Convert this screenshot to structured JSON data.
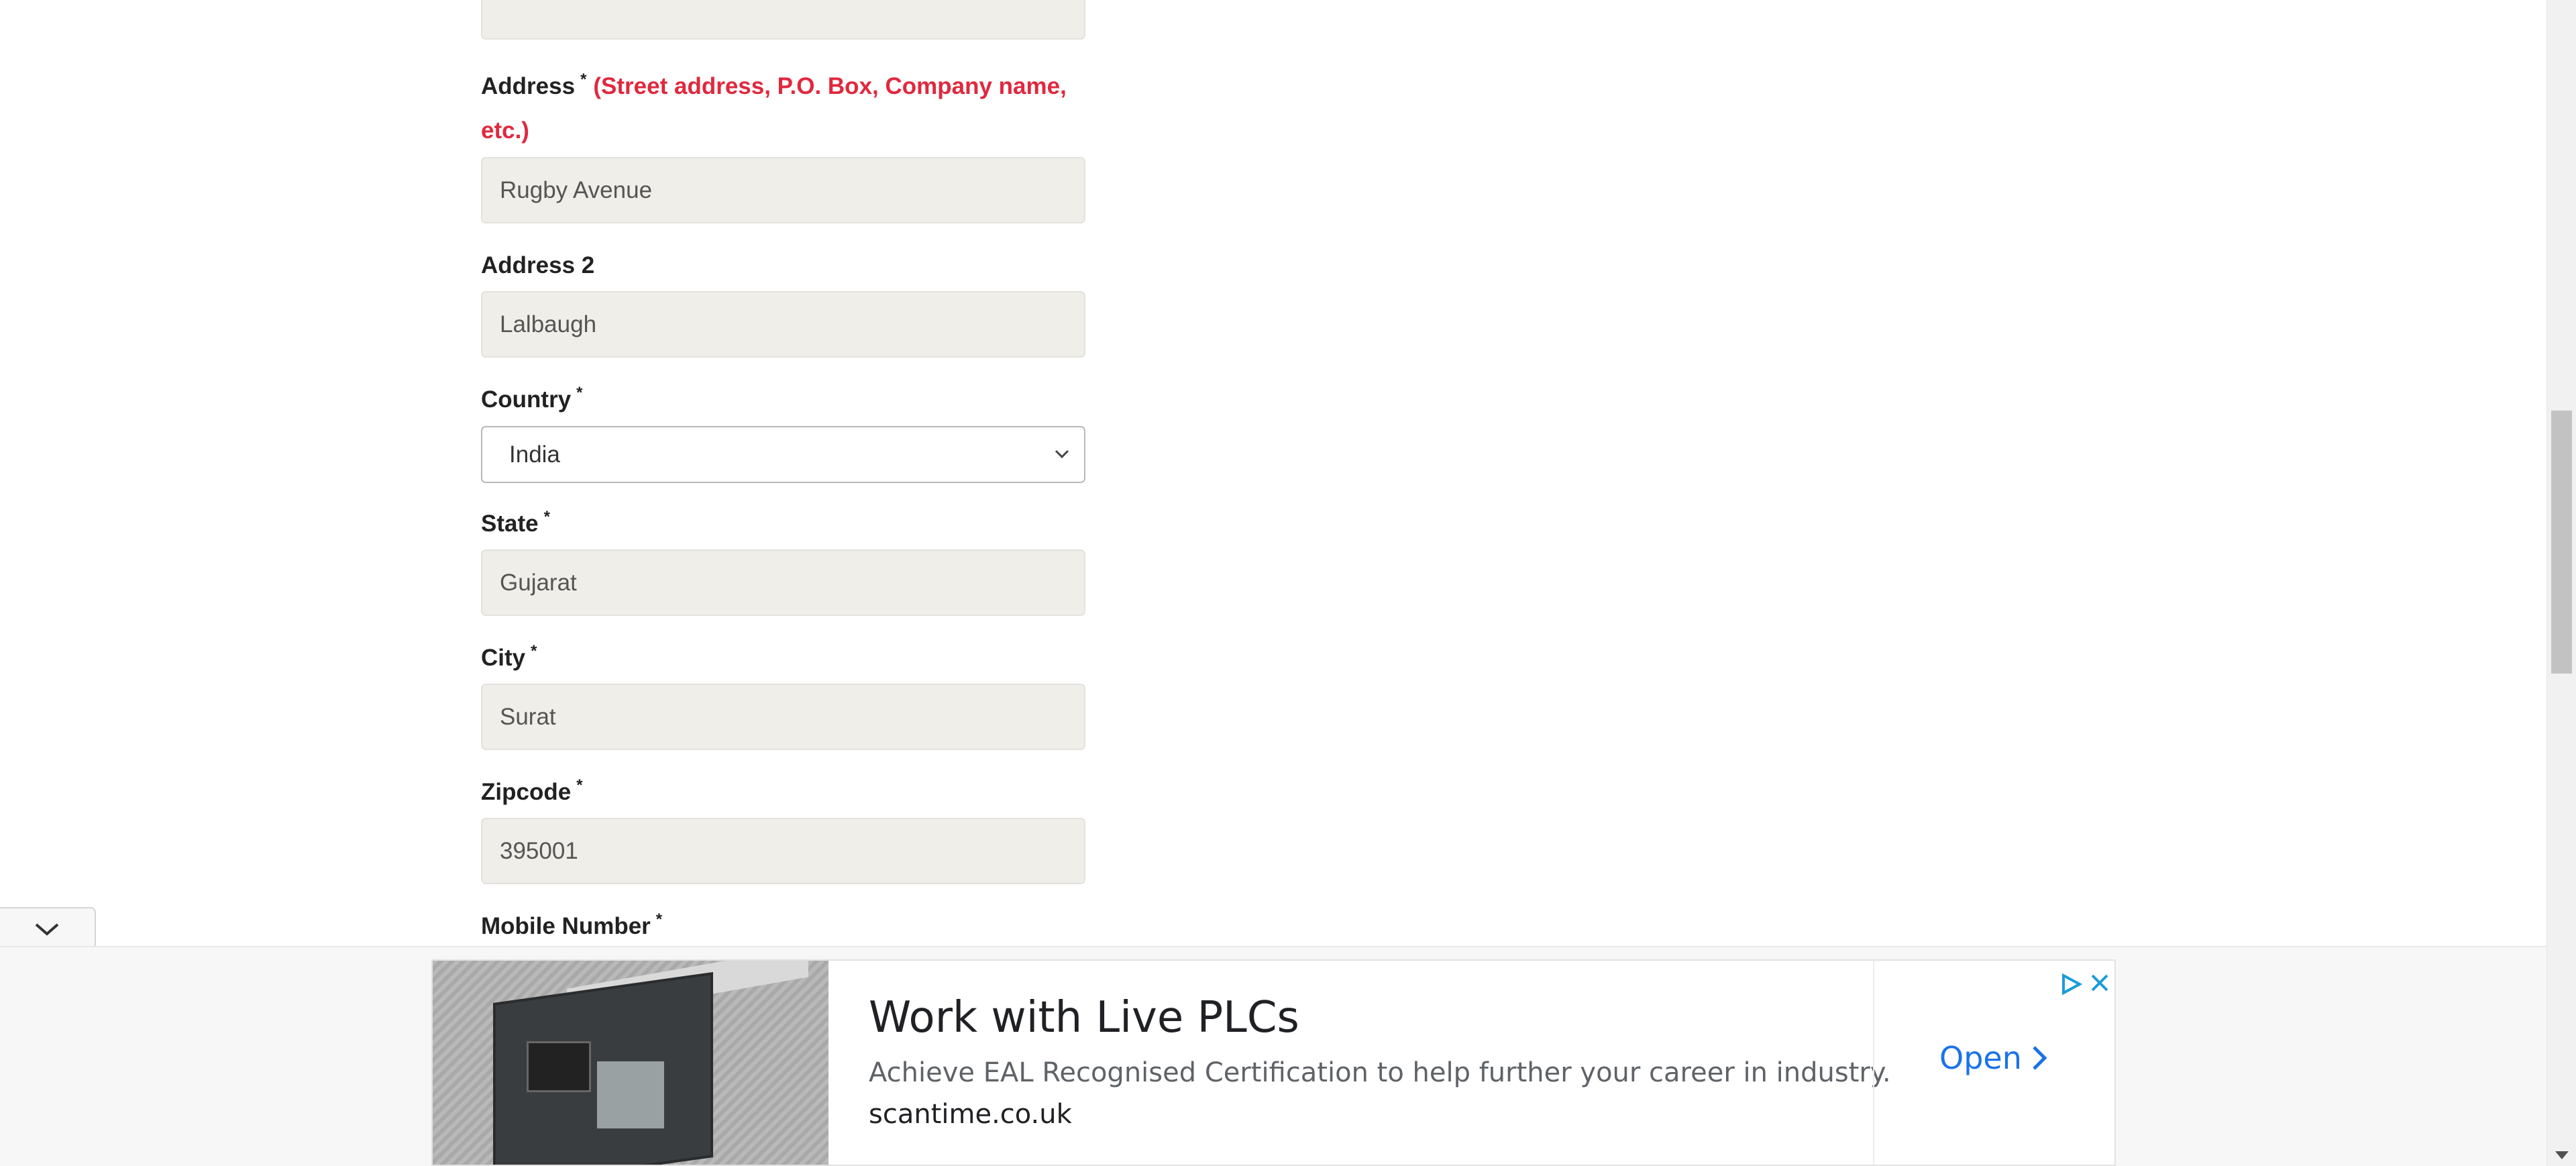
{
  "form": {
    "address": {
      "label": "Address",
      "required_mark": "*",
      "hint": "(Street address, P.O. Box, Company name, etc.)",
      "value": "Rugby Avenue"
    },
    "address2": {
      "label": "Address 2",
      "value": "Lalbaugh"
    },
    "country": {
      "label": "Country",
      "required_mark": "*",
      "selected": "India"
    },
    "state": {
      "label": "State",
      "required_mark": "*",
      "value": "Gujarat"
    },
    "city": {
      "label": "City",
      "required_mark": "*",
      "value": "Surat"
    },
    "zipcode": {
      "label": "Zipcode",
      "required_mark": "*",
      "value": "395001"
    },
    "mobile": {
      "label": "Mobile Number",
      "required_mark": "*"
    }
  },
  "ad": {
    "title": "Work with Live PLCs",
    "description": "Achieve EAL Recognised Certification to help further your career in industry.",
    "domain": "scantime.co.uk",
    "cta_label": "Open",
    "cta_color": "#1a73e8",
    "image_icon": "plc-device-photo",
    "choices_icon": "adchoices-icon",
    "close_icon": "close-icon"
  },
  "colors": {
    "hint": "#e0283e",
    "field_bg": "#efeee8"
  }
}
